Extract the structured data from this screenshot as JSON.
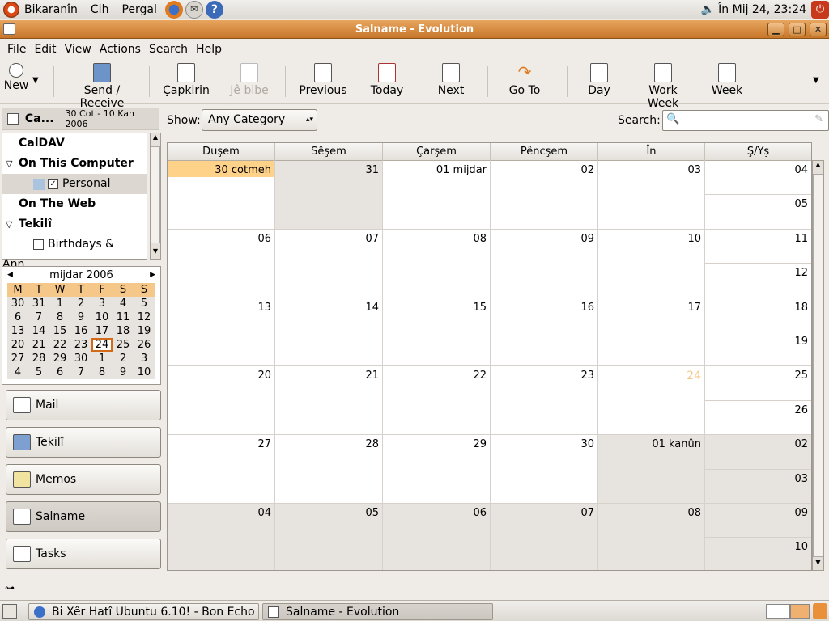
{
  "top_panel": {
    "menus": [
      "Bikaranîn",
      "Cih",
      "Pergal"
    ],
    "clock": "În Mij 24, 23:24"
  },
  "window": {
    "title": "Salname - Evolution"
  },
  "menubar": [
    "File",
    "Edit",
    "View",
    "Actions",
    "Search",
    "Help"
  ],
  "toolbar": {
    "new": "New",
    "send_receive": "Send / Receive",
    "print": "Çapkirin",
    "delete": "Jê bibe",
    "previous": "Previous",
    "today": "Today",
    "next": "Next",
    "goto": "Go To",
    "day": "Day",
    "work_week": "Work Week",
    "week": "Week"
  },
  "sidebar": {
    "header_title": "Ca...",
    "header_range": "30 Cot - 10 Kan 2006",
    "sources": {
      "caldav": "CalDAV",
      "on_this_computer": "On This Computer",
      "personal": "Personal",
      "on_the_web": "On The Web",
      "tekili": "Tekilî",
      "birthdays": "Birthdays & Ann..."
    }
  },
  "mini_calendar": {
    "month": "mijdar 2006",
    "weekdays": [
      "M",
      "T",
      "W",
      "T",
      "F",
      "S",
      "S"
    ],
    "days": [
      "30",
      "31",
      "1",
      "2",
      "3",
      "4",
      "5",
      "6",
      "7",
      "8",
      "9",
      "10",
      "11",
      "12",
      "13",
      "14",
      "15",
      "16",
      "17",
      "18",
      "19",
      "20",
      "21",
      "22",
      "23",
      "24",
      "25",
      "26",
      "27",
      "28",
      "29",
      "30",
      "1",
      "2",
      "3",
      "4",
      "5",
      "6",
      "7",
      "8",
      "9",
      "10"
    ],
    "today": "24"
  },
  "switcher": {
    "mail": "Mail",
    "contacts": "Tekilî",
    "memos": "Memos",
    "calendar": "Salname",
    "tasks": "Tasks"
  },
  "show_bar": {
    "show_label": "Show:",
    "category": "Any Category",
    "search_label": "Search:"
  },
  "month_view": {
    "day_headers": [
      "Duşem",
      "Sêşem",
      "Çarşem",
      "Pêncşem",
      "În",
      "Ş/Yş"
    ],
    "weeks": [
      [
        "30 cotmeh",
        "31",
        "01 mijdar",
        "02",
        "03",
        "04",
        "05"
      ],
      [
        "06",
        "07",
        "08",
        "09",
        "10",
        "11",
        "12"
      ],
      [
        "13",
        "14",
        "15",
        "16",
        "17",
        "18",
        "19"
      ],
      [
        "20",
        "21",
        "22",
        "23",
        "24",
        "25",
        "26"
      ],
      [
        "27",
        "28",
        "29",
        "30",
        "01 kanûn",
        "02",
        "03"
      ],
      [
        "04",
        "05",
        "06",
        "07",
        "08",
        "09",
        "10"
      ]
    ],
    "today_color": "#f5c889",
    "selected_color": "#ffd28a"
  },
  "taskbar": {
    "task1": "Bi Xêr Hatî Ubuntu 6.10! - Bon Echo",
    "task2": "Salname - Evolution"
  }
}
